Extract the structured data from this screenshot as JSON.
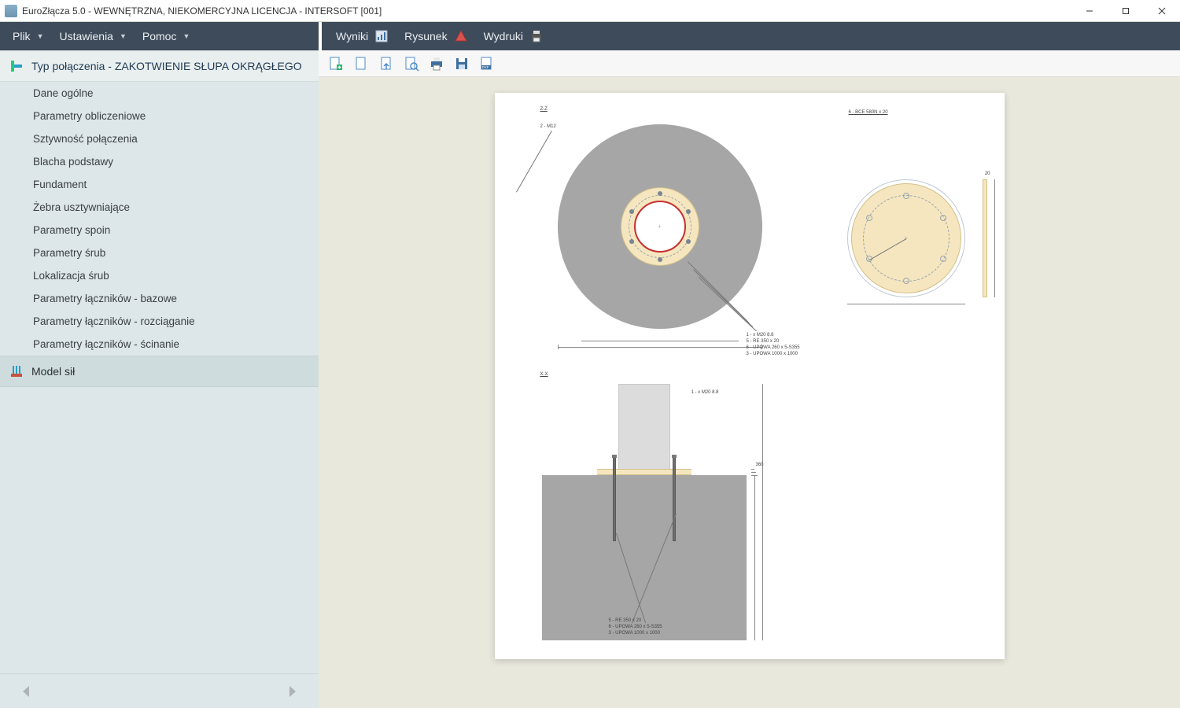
{
  "window": {
    "title": "EuroZłącza 5.0 - WEWNĘTRZNA, NIEKOMERCYJNA LICENCJA - INTERSOFT [001]"
  },
  "menubar_left": {
    "items": [
      {
        "label": "Plik",
        "has_dropdown": true
      },
      {
        "label": "Ustawienia",
        "has_dropdown": true
      },
      {
        "label": "Pomoc",
        "has_dropdown": true
      }
    ]
  },
  "menubar_right": {
    "items": [
      {
        "label": "Wyniki"
      },
      {
        "label": "Rysunek"
      },
      {
        "label": "Wydruki"
      }
    ]
  },
  "sidebar": {
    "header": "Typ połączenia - ZAKOTWIENIE SŁUPA OKRĄGŁEGO",
    "items": [
      "Dane ogólne",
      "Parametry obliczeniowe",
      "Sztywność połączenia",
      "Blacha podstawy",
      "Fundament",
      "Żebra usztywniające",
      "Parametry spoin",
      "Parametry śrub",
      "Lokalizacja śrub",
      "Parametry łączników - bazowe",
      "Parametry łączników - rozciąganie",
      "Parametry łączników - ścinanie"
    ],
    "footer": "Model sił"
  },
  "doc_toolbar": {
    "buttons": [
      "new-page",
      "page",
      "page-import",
      "page-inspect",
      "print",
      "save",
      "export-dxf"
    ]
  },
  "drawing": {
    "view_zz_label": "Z-Z",
    "view_xx_label": "X-X",
    "item1_label": "2 - M12",
    "part_title_right": "6 - BCE 580N x 20",
    "callout1": "1 - x M20 8.8",
    "callout2": "5 - RE 350 x 20",
    "callout3": "6 - UPOWA 260 x 5-S355",
    "callout4": "3 - UPOWA 1000 x 1000",
    "elev_callout1": "1 - x M20 8.8",
    "elev_callout2": "5 - RE 350 x 20",
    "elev_callout3": "6 - UPOWA 260 x 5-S355",
    "elev_callout4": "3 - UPOWA 1000 x 1000",
    "side_dim_label": "20",
    "elev_dim_label": "360",
    "colors": {
      "panel_bg": "#e8e8dd",
      "sidebar_bg": "#dde6e8",
      "menubar_bg": "#3d4b5a",
      "concrete": "#a6a6a6",
      "plate": "#f5e6bf",
      "pipe_outline": "#c53030",
      "bolt": "#7a8591"
    }
  }
}
